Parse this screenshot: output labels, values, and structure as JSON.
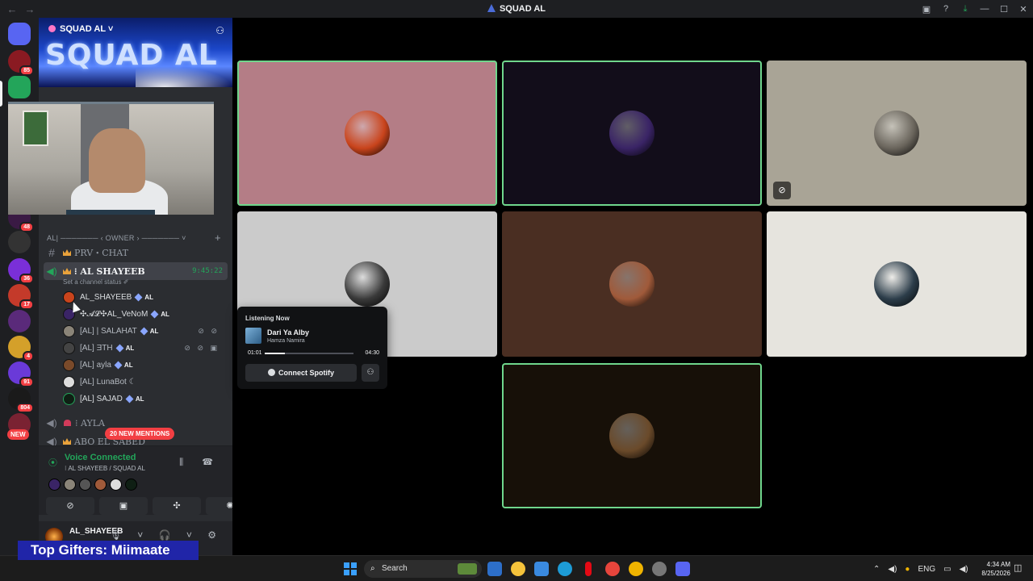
{
  "window": {
    "title": "SQUAD AL",
    "back": "←",
    "forward": "→",
    "inbox_icon": "▣",
    "help_icon": "?",
    "download_icon": "⤓",
    "min": "—",
    "max": "☐",
    "close": "✕"
  },
  "rail": {
    "badges": [
      "85",
      "48",
      "36",
      "17",
      "4",
      "91",
      "804"
    ],
    "new_label": "NEW"
  },
  "server": {
    "name": "SQUAD AL ˅",
    "banner_text": "SQUAD AL",
    "invite_icon": "person-add-icon"
  },
  "channels": {
    "category": "AL| ─────── ‹ OWNER › ─────── ˅",
    "add": "+",
    "prv_chat": "PRV・CHAT",
    "active_voice": {
      "name": "⁝ AL SHAYEEB",
      "time": "9:45:22",
      "status": "Set a channel status ✐"
    },
    "members": [
      {
        "name": "AL_SHAYEEB",
        "tag": "AL",
        "icons": ""
      },
      {
        "name": "✣𝓐𝓛✣AL_VeNoM",
        "tag": "AL",
        "icons": ""
      },
      {
        "name": "[AL] | SALAHAT",
        "tag": "AL",
        "icons": "⊘ ⊘"
      },
      {
        "name": "[AL]  ƎTH",
        "tag": "AL",
        "icons": "⊘ ⊘ ▣"
      },
      {
        "name": "[AL]  ayla",
        "tag": "AL",
        "icons": ""
      },
      {
        "name": "[AL]  LunaBot ☾",
        "tag": "",
        "icons": ""
      },
      {
        "name": "[AL]  SAJAD",
        "tag": "AL",
        "icons": ""
      }
    ],
    "ayla": "⁝ AYLA",
    "abo": "ABO EL SABED",
    "mentions": "20 NEW MENTIONS"
  },
  "voice": {
    "status": "Voice Connected",
    "location": "⁝ AL SHAYEEB / SQUAD AL",
    "buttons": [
      "⊘",
      "▣",
      "✣",
      "✺"
    ]
  },
  "user": {
    "name": "AL_SHAYEEB",
    "controls": "🎙 ˅ 🎧 ˅ ⚙"
  },
  "overlay": {
    "gifters": "Top Gifters: Miimaate"
  },
  "spotify": {
    "heading": "Listening Now",
    "song": "Dari Ya Alby",
    "artist": "Hamza Namira",
    "elapsed": "01:01",
    "duration": "04:30",
    "progress": 0.23,
    "connect": "Connect Spotify"
  },
  "tiles": [
    {
      "bg": "#b47d86",
      "avatar": "#c9441c",
      "speaking": true
    },
    {
      "bg": "#120d1a",
      "avatar": "#3a2466",
      "speaking": true
    },
    {
      "bg": "#a9a496",
      "avatar": "#6a655c",
      "speaking": false,
      "muted": true
    },
    {
      "bg": "#cbcbcb",
      "avatar": "#3a3a3a",
      "speaking": false
    },
    {
      "bg": "#4a2e22",
      "avatar": "#a05a3a",
      "speaking": false
    },
    {
      "bg": "#e6e4de",
      "avatar": "#2c3d4a",
      "speaking": false
    },
    {
      "bg": "#171008",
      "avatar": "#6a4a2a",
      "speaking": true
    }
  ],
  "taskbar": {
    "search": "Search",
    "lang": "ENG",
    "time": "4:34 AM",
    "date": "8/25/2026"
  },
  "colors": {
    "speaking": "#6fd68c",
    "accent_green": "#23a55a",
    "mention_red": "#f23f43"
  }
}
